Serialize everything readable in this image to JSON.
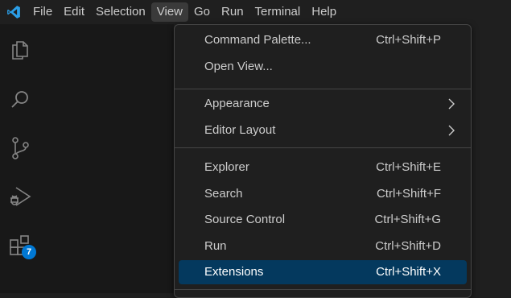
{
  "menubar": {
    "items": [
      "File",
      "Edit",
      "Selection",
      "View",
      "Go",
      "Run",
      "Terminal",
      "Help"
    ],
    "active": "View"
  },
  "activitybar": {
    "icons": [
      "explorer-icon",
      "search-icon",
      "source-control-icon",
      "run-debug-icon",
      "extensions-icon"
    ],
    "extensions_badge": "7",
    "badge_color": "#0078d4"
  },
  "view_menu": {
    "group1": [
      {
        "label": "Command Palette...",
        "key": "Ctrl+Shift+P"
      },
      {
        "label": "Open View...",
        "key": ""
      }
    ],
    "group2": [
      {
        "label": "Appearance",
        "submenu": true
      },
      {
        "label": "Editor Layout",
        "submenu": true
      }
    ],
    "group3": [
      {
        "label": "Explorer",
        "key": "Ctrl+Shift+E"
      },
      {
        "label": "Search",
        "key": "Ctrl+Shift+F"
      },
      {
        "label": "Source Control",
        "key": "Ctrl+Shift+G"
      },
      {
        "label": "Run",
        "key": "Ctrl+Shift+D"
      },
      {
        "label": "Extensions",
        "key": "Ctrl+Shift+X"
      }
    ],
    "selected": "Extensions",
    "selected_color": "#04395e"
  }
}
